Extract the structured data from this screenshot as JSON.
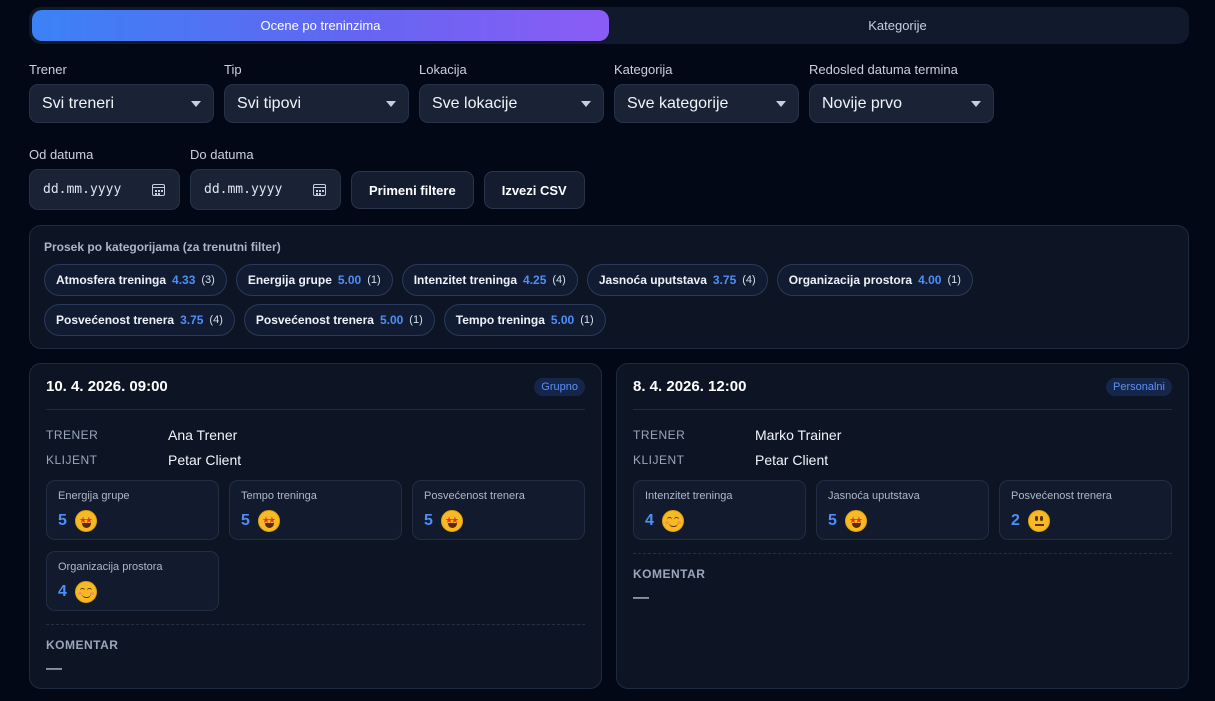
{
  "tabs": [
    {
      "label": "Ocene po treninzima",
      "active": true
    },
    {
      "label": "Kategorije",
      "active": false
    }
  ],
  "filters": {
    "trainer": {
      "label": "Trener",
      "value": "Svi treneri"
    },
    "type": {
      "label": "Tip",
      "value": "Svi tipovi"
    },
    "location": {
      "label": "Lokacija",
      "value": "Sve lokacije"
    },
    "category": {
      "label": "Kategorija",
      "value": "Sve kategorije"
    },
    "order": {
      "label": "Redosled datuma termina",
      "value": "Novije prvo"
    },
    "from": {
      "label": "Od datuma",
      "placeholder": "dd.mm.yyyy"
    },
    "to": {
      "label": "Do datuma",
      "placeholder": "dd.mm.yyyy"
    },
    "apply_label": "Primeni filtere",
    "export_label": "Izvezi CSV"
  },
  "averages": {
    "title": "Prosek po kategorijama (za trenutni filter)",
    "items": [
      {
        "name": "Atmosfera treninga",
        "score": "4.33",
        "count": "(3)"
      },
      {
        "name": "Energija grupe",
        "score": "5.00",
        "count": "(1)"
      },
      {
        "name": "Intenzitet treninga",
        "score": "4.25",
        "count": "(4)"
      },
      {
        "name": "Jasnoća uputstava",
        "score": "3.75",
        "count": "(4)"
      },
      {
        "name": "Organizacija prostora",
        "score": "4.00",
        "count": "(1)"
      },
      {
        "name": "Posvećenost trenera",
        "score": "3.75",
        "count": "(4)"
      },
      {
        "name": "Posvećenost trenera",
        "score": "5.00",
        "count": "(1)"
      },
      {
        "name": "Tempo treninga",
        "score": "5.00",
        "count": "(1)"
      }
    ]
  },
  "sessions": [
    {
      "date": "10. 4. 2026. 09:00",
      "badge": "Grupno",
      "trainer_key": "TRENER",
      "trainer": "Ana Trener",
      "client_key": "KLIJENT",
      "client": "Petar Client",
      "ratings": [
        {
          "name": "Energija grupe",
          "score": "5",
          "emoji": "star-struck"
        },
        {
          "name": "Tempo treninga",
          "score": "5",
          "emoji": "star-struck"
        },
        {
          "name": "Posvećenost trenera",
          "score": "5",
          "emoji": "star-struck"
        },
        {
          "name": "Organizacija prostora",
          "score": "4",
          "emoji": "smiling"
        }
      ],
      "comment_label": "KOMENTAR",
      "comment": "—"
    },
    {
      "date": "8. 4. 2026. 12:00",
      "badge": "Personalni",
      "trainer_key": "TRENER",
      "trainer": "Marko Trainer",
      "client_key": "KLIJENT",
      "client": "Petar Client",
      "ratings": [
        {
          "name": "Intenzitet treninga",
          "score": "4",
          "emoji": "smiling"
        },
        {
          "name": "Jasnoća uputstava",
          "score": "5",
          "emoji": "star-struck"
        },
        {
          "name": "Posvećenost trenera",
          "score": "2",
          "emoji": "neutral"
        }
      ],
      "comment_label": "KOMENTAR",
      "comment": "—"
    }
  ]
}
